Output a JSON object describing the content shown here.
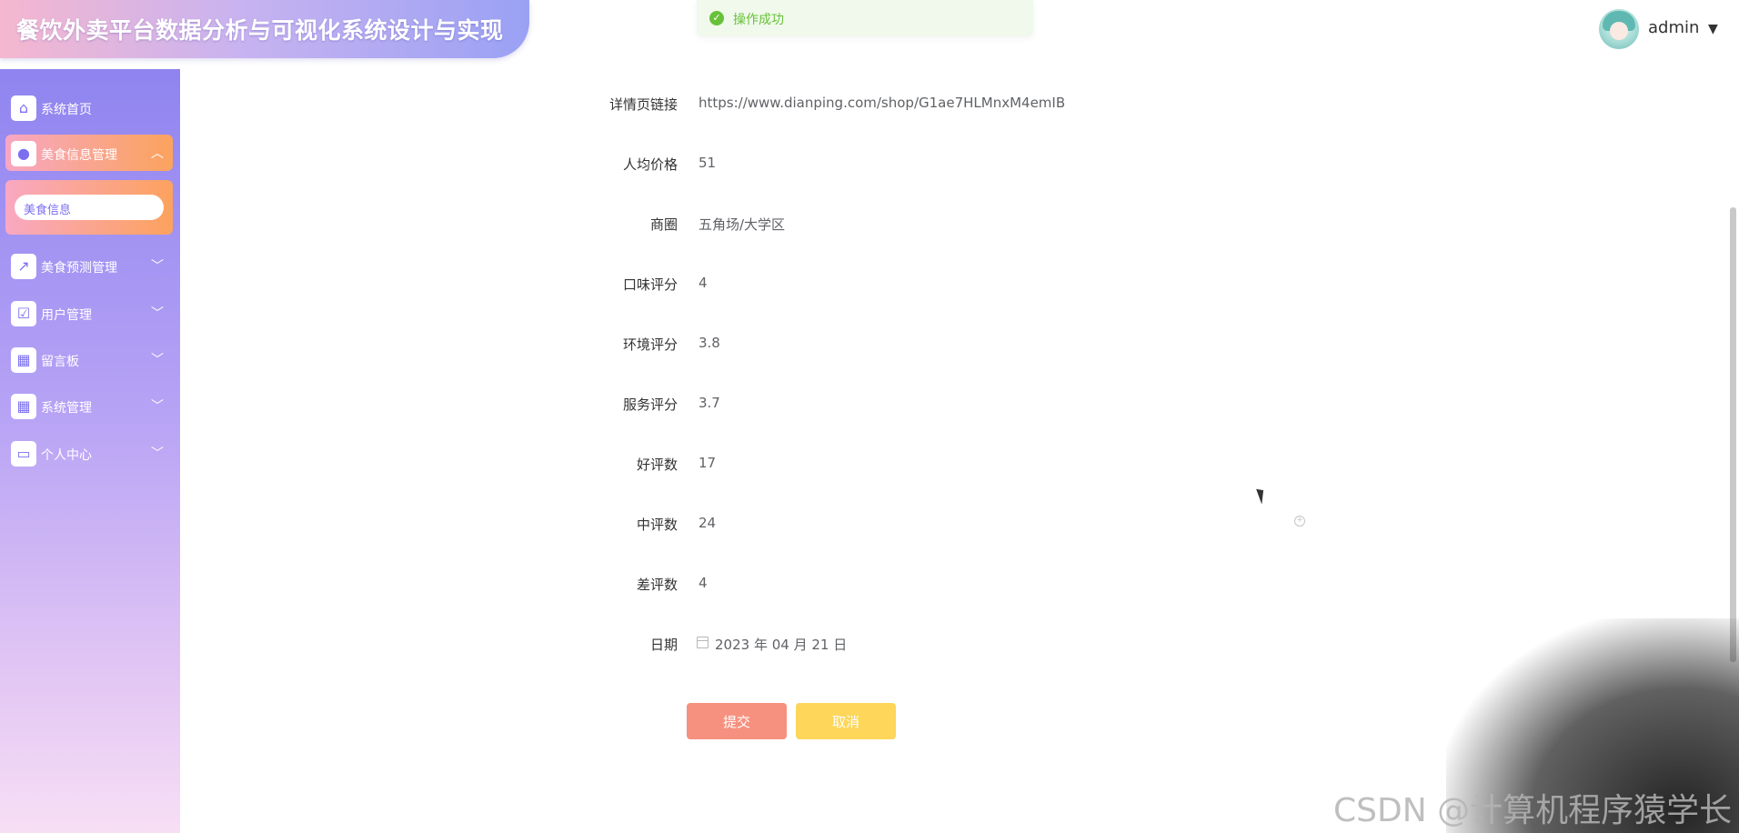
{
  "app": {
    "title": "餐饮外卖平台数据分析与可视化系统设计与实现"
  },
  "toast": {
    "message": "操作成功",
    "icon": "check-circle-icon",
    "color": "#67c23a"
  },
  "user": {
    "name": "admin"
  },
  "sidebar": {
    "items": [
      {
        "label": "系统首页",
        "icon": "home-icon"
      },
      {
        "label": "美食信息管理",
        "icon": "bulb-icon",
        "expanded": true,
        "submenu": [
          {
            "label": "美食信息"
          }
        ]
      },
      {
        "label": "美食预测管理",
        "icon": "trend-chart-icon"
      },
      {
        "label": "用户管理",
        "icon": "clipboard-check-icon"
      },
      {
        "label": "留言板",
        "icon": "grid-icon"
      },
      {
        "label": "系统管理",
        "icon": "grid-icon"
      },
      {
        "label": "个人中心",
        "icon": "wallet-icon"
      }
    ]
  },
  "form": {
    "fields": [
      {
        "label": "详情页链接",
        "value": "https://www.dianping.com/shop/G1ae7HLMnxM4emIB"
      },
      {
        "label": "人均价格",
        "value": "51"
      },
      {
        "label": "商圈",
        "value": "五角场/大学区"
      },
      {
        "label": "口味评分",
        "value": "4"
      },
      {
        "label": "环境评分",
        "value": "3.8"
      },
      {
        "label": "服务评分",
        "value": "3.7"
      },
      {
        "label": "好评数",
        "value": "17"
      },
      {
        "label": "中评数",
        "value": "24"
      },
      {
        "label": "差评数",
        "value": "4"
      },
      {
        "label": "日期",
        "value": "2023 年 04 月 21 日"
      }
    ],
    "submit_label": "提交",
    "cancel_label": "取消"
  },
  "watermark": "CSDN @计算机程序猿学长",
  "colors": {
    "submit": "#f6917f",
    "cancel": "#fdd65a",
    "sidebar_top": "#8f84f0",
    "accent": "#7b6ff0"
  }
}
